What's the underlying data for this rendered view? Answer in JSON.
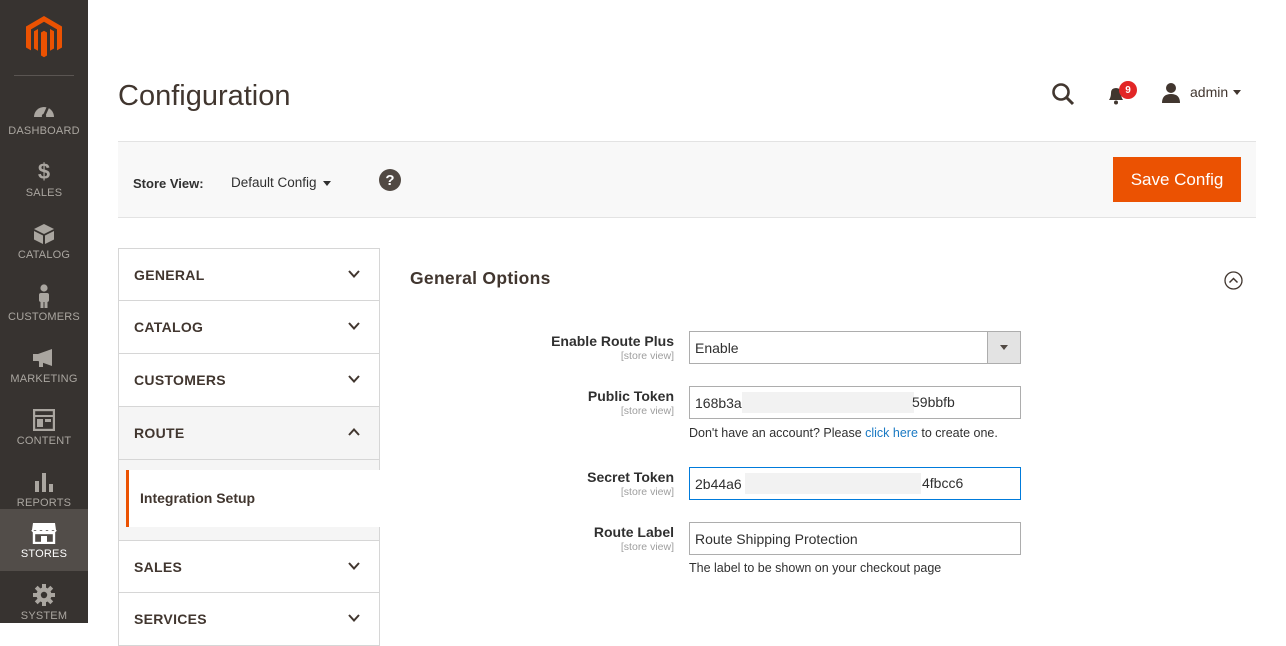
{
  "sidebar": {
    "items": [
      {
        "label": "DASHBOARD",
        "icon": "dashboard-icon"
      },
      {
        "label": "SALES",
        "icon": "dollar-icon"
      },
      {
        "label": "CATALOG",
        "icon": "box-icon"
      },
      {
        "label": "CUSTOMERS",
        "icon": "person-icon"
      },
      {
        "label": "MARKETING",
        "icon": "megaphone-icon"
      },
      {
        "label": "CONTENT",
        "icon": "layout-icon"
      },
      {
        "label": "REPORTS",
        "icon": "bar-chart-icon"
      },
      {
        "label": "STORES",
        "icon": "store-icon",
        "active": true
      },
      {
        "label": "SYSTEM",
        "icon": "gear-icon"
      }
    ]
  },
  "header": {
    "title": "Configuration",
    "notifications_count": "9",
    "user": "admin"
  },
  "scope": {
    "label": "Store View:",
    "value": "Default Config",
    "help": "?",
    "save_label": "Save Config"
  },
  "tabs": {
    "general": "GENERAL",
    "catalog": "CATALOG",
    "customers": "CUSTOMERS",
    "route": "ROUTE",
    "route_sub": "Integration Setup",
    "sales": "SALES",
    "services": "SERVICES"
  },
  "section": {
    "title": "General Options",
    "fields": {
      "enable": {
        "label": "Enable Route Plus",
        "scope": "[store view]",
        "value": "Enable"
      },
      "public_token": {
        "label": "Public Token",
        "scope": "[store view]",
        "value_start": "168b3a",
        "value_end": "59bbfb"
      },
      "public_note": {
        "before": "Don't have an account? Please ",
        "link": "click here",
        "after": " to create one."
      },
      "secret_token": {
        "label": "Secret Token",
        "scope": "[store view]",
        "value_start": "2b44a6",
        "value_end": "4fbcc6"
      },
      "route_label": {
        "label": "Route Label",
        "scope": "[store view]",
        "value": "Route Shipping Protection"
      },
      "route_note": "The label to be shown on your checkout page"
    }
  },
  "colors": {
    "sidebar_bg": "#373330",
    "accent": "#eb5202",
    "link": "#1979c3"
  }
}
